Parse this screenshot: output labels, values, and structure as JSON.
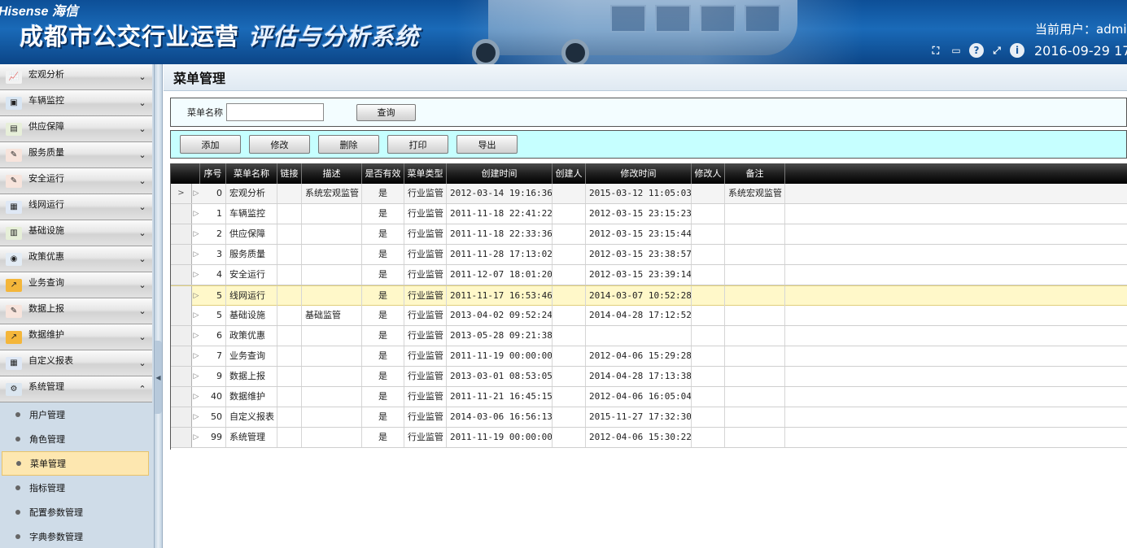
{
  "header": {
    "logo": "Hisense 海信",
    "title_main": "成都市公交行业运营",
    "title_italic": "评估与分析系统",
    "user_label": "当前用户：admin",
    "datetime": "2016-09-29 17",
    "icons": [
      "crop-icon",
      "keyboard-icon",
      "help-icon",
      "fullscreen-icon",
      "info-icon"
    ]
  },
  "sidebar": {
    "items": [
      {
        "label": "宏观分析",
        "icon": "chart-icon",
        "expanded": false
      },
      {
        "label": "车辆监控",
        "icon": "monitor-icon",
        "expanded": false
      },
      {
        "label": "供应保障",
        "icon": "supply-icon",
        "expanded": false
      },
      {
        "label": "服务质量",
        "icon": "edit-icon",
        "expanded": false
      },
      {
        "label": "安全运行",
        "icon": "edit-icon",
        "expanded": false
      },
      {
        "label": "线网运行",
        "icon": "calendar-icon",
        "expanded": false
      },
      {
        "label": "基础设施",
        "icon": "facility-icon",
        "expanded": false
      },
      {
        "label": "政策优惠",
        "icon": "policy-icon",
        "expanded": false
      },
      {
        "label": "业务查询",
        "icon": "trend-icon",
        "expanded": false
      },
      {
        "label": "数据上报",
        "icon": "edit-icon",
        "expanded": false
      },
      {
        "label": "数据维护",
        "icon": "trend-icon",
        "expanded": false
      },
      {
        "label": "自定义报表",
        "icon": "calendar-icon",
        "expanded": false
      },
      {
        "label": "系统管理",
        "icon": "settings-icon",
        "expanded": true
      }
    ],
    "sub_items": [
      {
        "label": "用户管理",
        "active": false
      },
      {
        "label": "角色管理",
        "active": false
      },
      {
        "label": "菜单管理",
        "active": true
      },
      {
        "label": "指标管理",
        "active": false
      },
      {
        "label": "配置参数管理",
        "active": false
      },
      {
        "label": "字典参数管理",
        "active": false
      }
    ]
  },
  "main": {
    "page_title": "菜单管理",
    "search": {
      "label": "菜单名称",
      "value": "",
      "placeholder": "",
      "button": "查询"
    },
    "toolbar": {
      "add": "添加",
      "edit": "修改",
      "delete": "删除",
      "print": "打印",
      "export": "导出"
    },
    "columns": [
      "序号",
      "菜单名称",
      "链接",
      "描述",
      "是否有效",
      "菜单类型",
      "创建时间",
      "创建人",
      "修改时间",
      "修改人",
      "备注"
    ],
    "rows": [
      {
        "no": "0",
        "name": "宏观分析",
        "link": "",
        "desc": "系统宏观监管",
        "valid": "是",
        "type": "行业监管",
        "created": "2012-03-14 19:16:36",
        "creator": "",
        "modified": "2015-03-12 11:05:03",
        "modifier": "",
        "remark": "系统宏观监管"
      },
      {
        "no": "1",
        "name": "车辆监控",
        "link": "",
        "desc": "",
        "valid": "是",
        "type": "行业监管",
        "created": "2011-11-18 22:41:22",
        "creator": "",
        "modified": "2012-03-15 23:15:23",
        "modifier": "",
        "remark": ""
      },
      {
        "no": "2",
        "name": "供应保障",
        "link": "",
        "desc": "",
        "valid": "是",
        "type": "行业监管",
        "created": "2011-11-18 22:33:36",
        "creator": "",
        "modified": "2012-03-15 23:15:44",
        "modifier": "",
        "remark": ""
      },
      {
        "no": "3",
        "name": "服务质量",
        "link": "",
        "desc": "",
        "valid": "是",
        "type": "行业监管",
        "created": "2011-11-28 17:13:02",
        "creator": "",
        "modified": "2012-03-15 23:38:57",
        "modifier": "",
        "remark": ""
      },
      {
        "no": "4",
        "name": "安全运行",
        "link": "",
        "desc": "",
        "valid": "是",
        "type": "行业监管",
        "created": "2011-12-07 18:01:20",
        "creator": "",
        "modified": "2012-03-15 23:39:14",
        "modifier": "",
        "remark": ""
      },
      {
        "no": "5",
        "name": "线网运行",
        "link": "",
        "desc": "",
        "valid": "是",
        "type": "行业监管",
        "created": "2011-11-17 16:53:46",
        "creator": "",
        "modified": "2014-03-07 10:52:28",
        "modifier": "",
        "remark": ""
      },
      {
        "no": "5",
        "name": "基础设施",
        "link": "",
        "desc": "基础监管",
        "valid": "是",
        "type": "行业监管",
        "created": "2013-04-02 09:52:24",
        "creator": "",
        "modified": "2014-04-28 17:12:52",
        "modifier": "",
        "remark": ""
      },
      {
        "no": "6",
        "name": "政策优惠",
        "link": "",
        "desc": "",
        "valid": "是",
        "type": "行业监管",
        "created": "2013-05-28 09:21:38",
        "creator": "",
        "modified": "",
        "modifier": "",
        "remark": ""
      },
      {
        "no": "7",
        "name": "业务查询",
        "link": "",
        "desc": "",
        "valid": "是",
        "type": "行业监管",
        "created": "2011-11-19 00:00:00",
        "creator": "",
        "modified": "2012-04-06 15:29:28",
        "modifier": "",
        "remark": ""
      },
      {
        "no": "9",
        "name": "数据上报",
        "link": "",
        "desc": "",
        "valid": "是",
        "type": "行业监管",
        "created": "2013-03-01 08:53:05",
        "creator": "",
        "modified": "2014-04-28 17:13:38",
        "modifier": "",
        "remark": ""
      },
      {
        "no": "40",
        "name": "数据维护",
        "link": "",
        "desc": "",
        "valid": "是",
        "type": "行业监管",
        "created": "2011-11-21 16:45:15",
        "creator": "",
        "modified": "2012-04-06 16:05:04",
        "modifier": "",
        "remark": ""
      },
      {
        "no": "50",
        "name": "自定义报表",
        "link": "",
        "desc": "",
        "valid": "是",
        "type": "行业监管",
        "created": "2014-03-06 16:56:13",
        "creator": "",
        "modified": "2015-11-27 17:32:30",
        "modifier": "",
        "remark": ""
      },
      {
        "no": "99",
        "name": "系统管理",
        "link": "",
        "desc": "",
        "valid": "是",
        "type": "行业监管",
        "created": "2011-11-19 00:00:00",
        "creator": "",
        "modified": "2012-04-06 15:30:22",
        "modifier": "",
        "remark": ""
      }
    ],
    "selected_row": 5,
    "current_row": 0,
    "colors": {
      "selected_row_bg": "#fff8c9",
      "toolbar_bg": "#c6ffff",
      "header_bg": "#1a6ab8"
    }
  }
}
